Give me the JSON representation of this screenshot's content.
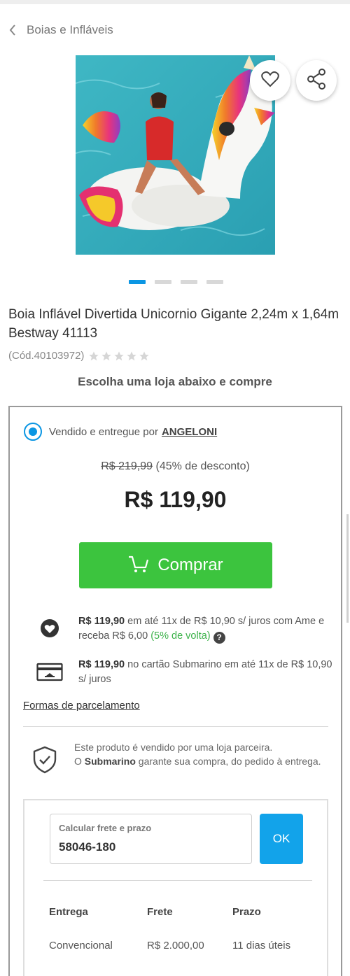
{
  "breadcrumb": {
    "label": "Boias e Infláveis"
  },
  "gallery": {
    "image_count": 4,
    "active_index": 0
  },
  "product": {
    "title": "Boia Inflável Divertida Unicornio Gigante 2,24m x 1,64m Bestway 41113",
    "code": "(Cód.40103972)",
    "rating_stars": 5
  },
  "choose_store": "Escolha uma loja abaixo e compre",
  "offer": {
    "sold_by_text": "Vendido e entregue por",
    "seller_name": "ANGELONI",
    "old_price": "R$ 219,99",
    "discount": "(45% de desconto)",
    "price": "R$ 119,90",
    "buy_label": "Comprar",
    "ame": {
      "amount": "R$ 119,90",
      "text": "em até 11x de R$ 10,90 s/ juros com Ame e receba R$ 6,00",
      "cashback": "(5% de volta)",
      "help": "?"
    },
    "card": {
      "amount": "R$ 119,90",
      "text": "no cartão Submarino em até 11x de R$ 10,90 s/ juros"
    },
    "installments_link": "Formas de parcelamento",
    "guarantee": {
      "line1": "Este produto é vendido por uma loja parceira.",
      "prefix": "O",
      "brand": "Submarino",
      "suffix": "garante sua compra, do pedido à entrega."
    }
  },
  "shipping": {
    "field_label": "Calcular frete e prazo",
    "cep_value": "58046-180",
    "ok_label": "OK",
    "headers": {
      "delivery": "Entrega",
      "fee": "Frete",
      "time": "Prazo"
    },
    "rows": [
      {
        "delivery": "Convencional",
        "fee": "R$ 2.000,00",
        "time": "11 dias úteis"
      }
    ]
  },
  "colors": {
    "accent": "#0b96e3",
    "buy": "#3cc43e",
    "ok": "#12a3ea",
    "cashback": "#3cb24a"
  }
}
